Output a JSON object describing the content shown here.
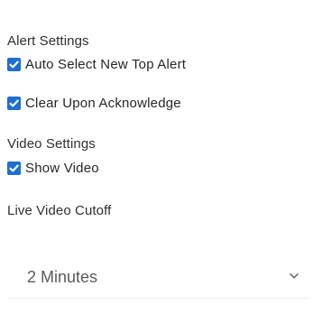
{
  "alert_settings": {
    "heading": "Alert Settings",
    "options": [
      {
        "label": "Auto Select New Top Alert",
        "checked": true
      },
      {
        "label": "Clear Upon Acknowledge",
        "checked": true
      }
    ]
  },
  "video_settings": {
    "heading": "Video Settings",
    "options": [
      {
        "label": "Show Video",
        "checked": true
      }
    ]
  },
  "live_video_cutoff": {
    "heading": "Live Video Cutoff",
    "selected": "2 Minutes"
  },
  "colors": {
    "checkbox": "#1f6fd1",
    "text": "#262626"
  },
  "icons": {
    "checkbox": "checkmark-icon",
    "dropdown": "chevron-down-icon"
  }
}
